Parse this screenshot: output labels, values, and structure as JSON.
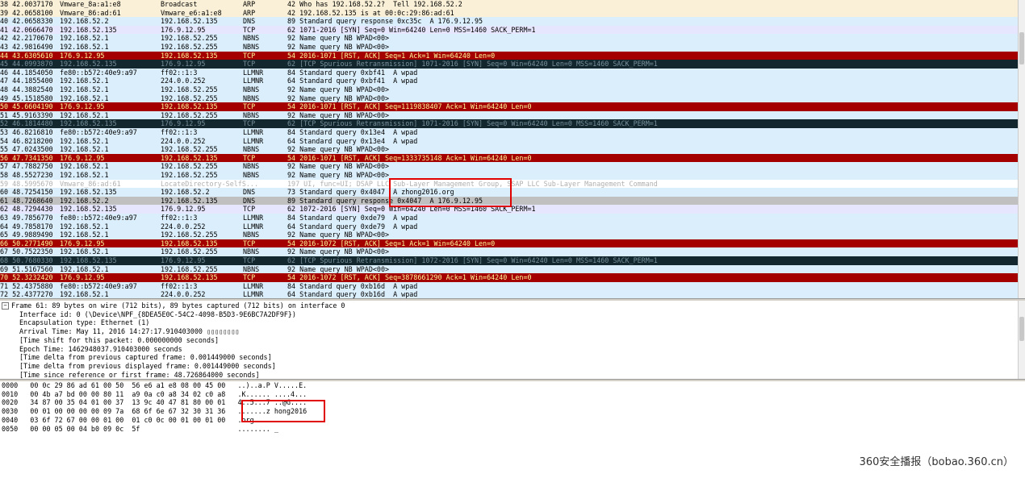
{
  "packets": [
    {
      "no": "38 42.0037170",
      "src": "Vmware_8a:a1:e8",
      "dst": "Broadcast",
      "proto": "ARP",
      "info": "42 Who has 192.168.52.2?  Tell 192.168.52.2",
      "style": "arp"
    },
    {
      "no": "39 42.0658100",
      "src": "Vmware_86:ad:61",
      "dst": "Vmware_e6:a1:e8",
      "proto": "ARP",
      "info": "42 192.168.52.135 is at 00:0c:29:86:ad:61",
      "style": "arp"
    },
    {
      "no": "40 42.0658330",
      "src": "192.168.52.2",
      "dst": "192.168.52.135",
      "proto": "DNS",
      "info": "89 Standard query response 0xc35c  A 176.9.12.95",
      "style": "dns"
    },
    {
      "no": "41 42.0666470",
      "src": "192.168.52.135",
      "dst": "176.9.12.95",
      "proto": "TCP",
      "info": "62 1071-2016 [SYN] Seq=0 Win=64240 Len=0 MSS=1460 SACK_PERM=1",
      "style": "tcp"
    },
    {
      "no": "42 42.2170670",
      "src": "192.168.52.1",
      "dst": "192.168.52.255",
      "proto": "NBNS",
      "info": "92 Name query NB WPAD<00>",
      "style": "default"
    },
    {
      "no": "43 42.9816490",
      "src": "192.168.52.1",
      "dst": "192.168.52.255",
      "proto": "NBNS",
      "info": "92 Name query NB WPAD<00>",
      "style": "default"
    },
    {
      "no": "44 43.6305610",
      "src": "176.9.12.95",
      "dst": "192.168.52.135",
      "proto": "TCP",
      "info": "54 2016-1071 [RST, ACK] Seq=1 Ack=1 Win=64240 Len=0",
      "style": "rst"
    },
    {
      "no": "45 44.0993870",
      "src": "192.168.52.135",
      "dst": "176.9.12.95",
      "proto": "TCP",
      "info": "62 [TCP Spurious Retransmission] 1071-2016 [SYN] Seq=0 Win=64240 Len=0 MSS=1460 SACK_PERM=1",
      "style": "dark"
    },
    {
      "no": "46 44.1854050",
      "src": "fe80::b572:40e9:a97",
      "dst": "ff02::1:3",
      "proto": "LLMNR",
      "info": "84 Standard query 0xbf41  A wpad",
      "style": "default"
    },
    {
      "no": "47 44.1855400",
      "src": "192.168.52.1",
      "dst": "224.0.0.252",
      "proto": "LLMNR",
      "info": "64 Standard query 0xbf41  A wpad",
      "style": "default"
    },
    {
      "no": "48 44.3882540",
      "src": "192.168.52.1",
      "dst": "192.168.52.255",
      "proto": "NBNS",
      "info": "92 Name query NB WPAD<00>",
      "style": "default"
    },
    {
      "no": "49 45.1518580",
      "src": "192.168.52.1",
      "dst": "192.168.52.255",
      "proto": "NBNS",
      "info": "92 Name query NB WPAD<00>",
      "style": "default"
    },
    {
      "no": "50 45.6604190",
      "src": "176.9.12.95",
      "dst": "192.168.52.135",
      "proto": "TCP",
      "info": "54 2016-1071 [RST, ACK] Seq=1119838407 Ack=1 Win=64240 Len=0",
      "style": "rst"
    },
    {
      "no": "51 45.9163390",
      "src": "192.168.52.1",
      "dst": "192.168.52.255",
      "proto": "NBNS",
      "info": "92 Name query NB WPAD<00>",
      "style": "default"
    },
    {
      "no": "52 46.1814480",
      "src": "192.168.52.135",
      "dst": "176.9.12.95",
      "proto": "TCP",
      "info": "62 [TCP Spurious Retransmission] 1071-2016 [SYN] Seq=0 Win=64240 Len=0 MSS=1460 SACK_PERM=1",
      "style": "dark"
    },
    {
      "no": "53 46.8216810",
      "src": "fe80::b572:40e9:a97",
      "dst": "ff02::1:3",
      "proto": "LLMNR",
      "info": "84 Standard query 0x13e4  A wpad",
      "style": "default"
    },
    {
      "no": "54 46.8218200",
      "src": "192.168.52.1",
      "dst": "224.0.0.252",
      "proto": "LLMNR",
      "info": "64 Standard query 0x13e4  A wpad",
      "style": "default"
    },
    {
      "no": "55 47.0243500",
      "src": "192.168.52.1",
      "dst": "192.168.52.255",
      "proto": "NBNS",
      "info": "92 Name query NB WPAD<00>",
      "style": "default"
    },
    {
      "no": "56 47.7341350",
      "src": "176.9.12.95",
      "dst": "192.168.52.135",
      "proto": "TCP",
      "info": "54 2016-1071 [RST, ACK] Seq=1333735148 Ack=1 Win=64240 Len=0",
      "style": "rst"
    },
    {
      "no": "57 47.7882750",
      "src": "192.168.52.1",
      "dst": "192.168.52.255",
      "proto": "NBNS",
      "info": "92 Name query NB WPAD<00>",
      "style": "default"
    },
    {
      "no": "58 48.5527230",
      "src": "192.168.52.1",
      "dst": "192.168.52.255",
      "proto": "NBNS",
      "info": "92 Name query NB WPAD<00>",
      "style": "default"
    },
    {
      "no": "59 48.5995670",
      "src": "Vmware_86:ad:61",
      "dst": "LocateDirectory-SelfS...",
      "proto": "",
      "info": "197 UI, func=UI; DSAP LLC Sub-Layer Management Group, SSAP LLC Sub-Layer Management Command",
      "style": "llc"
    },
    {
      "no": "60 48.7254150",
      "src": "192.168.52.135",
      "dst": "192.168.52.2",
      "proto": "DNS",
      "info": "73 Standard query 0x4047  A zhong2016.org",
      "style": "dns"
    },
    {
      "no": "61 48.7268640",
      "src": "192.168.52.2",
      "dst": "192.168.52.135",
      "proto": "DNS",
      "info": "89 Standard query response 0x4047  A 176.9.12.95",
      "style": "sel"
    },
    {
      "no": "62 48.7294430",
      "src": "192.168.52.135",
      "dst": "176.9.12.95",
      "proto": "TCP",
      "info": "62 1072-2016 [SYN] Seq=0 Win=64240 Len=0 MSS=1460 SACK_PERM=1",
      "style": "tcp"
    },
    {
      "no": "63 49.7856770",
      "src": "fe80::b572:40e9:a97",
      "dst": "ff02::1:3",
      "proto": "LLMNR",
      "info": "84 Standard query 0xde79  A wpad",
      "style": "default"
    },
    {
      "no": "64 49.7858170",
      "src": "192.168.52.1",
      "dst": "224.0.0.252",
      "proto": "LLMNR",
      "info": "64 Standard query 0xde79  A wpad",
      "style": "default"
    },
    {
      "no": "65 49.9889490",
      "src": "192.168.52.1",
      "dst": "192.168.52.255",
      "proto": "NBNS",
      "info": "92 Name query NB WPAD<00>",
      "style": "default"
    },
    {
      "no": "66 50.2771490",
      "src": "176.9.12.95",
      "dst": "192.168.52.135",
      "proto": "TCP",
      "info": "54 2016-1072 [RST, ACK] Seq=1 Ack=1 Win=64240 Len=0",
      "style": "rst"
    },
    {
      "no": "67 50.7522350",
      "src": "192.168.52.1",
      "dst": "192.168.52.255",
      "proto": "NBNS",
      "info": "92 Name query NB WPAD<00>",
      "style": "default"
    },
    {
      "no": "68 50.7680330",
      "src": "192.168.52.135",
      "dst": "176.9.12.95",
      "proto": "TCP",
      "info": "62 [TCP Spurious Retransmission] 1072-2016 [SYN] Seq=0 Win=64240 Len=0 MSS=1460 SACK_PERM=1",
      "style": "dark"
    },
    {
      "no": "69 51.5167560",
      "src": "192.168.52.1",
      "dst": "192.168.52.255",
      "proto": "NBNS",
      "info": "92 Name query NB WPAD<00>",
      "style": "default"
    },
    {
      "no": "70 52.3232420",
      "src": "176.9.12.95",
      "dst": "192.168.52.135",
      "proto": "TCP",
      "info": "54 2016-1072 [RST, ACK] Seq=3878661290 Ack=1 Win=64240 Len=0",
      "style": "rst"
    },
    {
      "no": "71 52.4375880",
      "src": "fe80::b572:40e9:a97",
      "dst": "ff02::1:3",
      "proto": "LLMNR",
      "info": "84 Standard query 0xb16d  A wpad",
      "style": "default"
    },
    {
      "no": "72 52.4377270",
      "src": "192.168.52.1",
      "dst": "224.0.0.252",
      "proto": "LLMNR",
      "info": "64 Standard query 0xb16d  A wpad",
      "style": "default"
    }
  ],
  "details": {
    "frame_header": "Frame 61: 89 bytes on wire (712 bits), 89 bytes captured (712 bits) on interface 0",
    "toggle": "−",
    "lines": [
      "Interface id: 0 (\\Device\\NPF_{8DEA5E0C-54C2-4098-B5D3-9E6BC7A2DF9F})",
      "Encapsulation type: Ethernet (1)",
      "Arrival Time: May 11, 2016 14:27:17.910403000 ▯▯▯▯▯▯▯▯",
      "[Time shift for this packet: 0.000000000 seconds]",
      "Epoch Time: 1462948037.910403000 seconds",
      "[Time delta from previous captured frame: 0.001449000 seconds]",
      "[Time delta from previous displayed frame: 0.001449000 seconds]",
      "[Time since reference or first frame: 48.726864000 seconds]"
    ]
  },
  "bytes": [
    "0000   00 0c 29 86 ad 61 00 50  56 e6 a1 e8 08 00 45 00   ..)..a.P V.....E.",
    "0010   00 4b a7 bd 00 00 80 11  a9 0a c0 a8 34 02 c0 a8   .K...... ....4...",
    "0020   34 87 00 35 04 01 00 37  13 9c 40 47 81 80 00 01   4..5...7 ..@G....",
    "0030   00 01 00 00 00 00 09 7a  68 6f 6e 67 32 30 31 36   .......z hong2016",
    "0040   03 6f 72 67 00 00 01 00  01 c0 0c 00 01 00 01 00   .org.... ........",
    "0050   00 00 05 00 04 b0 09 0c  5f                        ........ _"
  ],
  "watermark": "360安全播报（bobao.360.cn）",
  "colors": {
    "default": "#daeefb",
    "tcp": "#e7e6ff",
    "rst": "#a40000",
    "dark": "#12272e",
    "selected": "#c0c0c0",
    "highlight_box": "#e00000"
  }
}
